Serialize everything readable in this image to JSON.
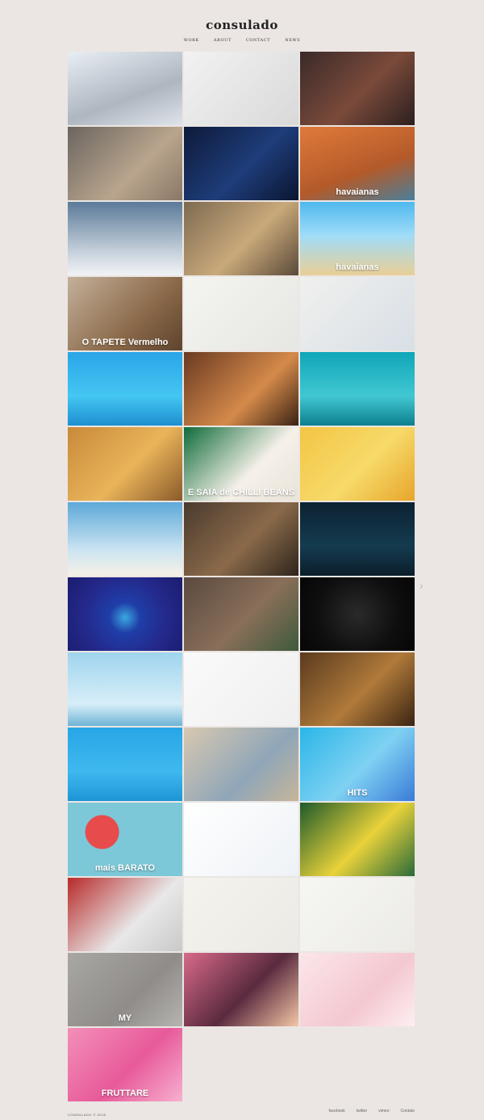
{
  "header": {
    "logo": "consulado",
    "nav": [
      {
        "key": "work",
        "label": "WORK"
      },
      {
        "key": "about",
        "label": "ABOUT"
      },
      {
        "key": "contact",
        "label": "CONTACT"
      },
      {
        "key": "news",
        "label": "NEWS"
      }
    ]
  },
  "tiles": [
    {
      "name": "car-wireframe",
      "label": "",
      "bg": "linear-gradient(160deg,#e9eef4,#aeb6c0 60%,#dfe4ea)"
    },
    {
      "name": "melitta-woman",
      "label": "",
      "bg": "linear-gradient(135deg,#f2f2f2,#d9d9d9)"
    },
    {
      "name": "animated-girl",
      "label": "",
      "bg": "linear-gradient(135deg,#3b2a2a,#7a4a3a 55%,#2b1f1f)"
    },
    {
      "name": "old-men-table",
      "label": "",
      "bg": "linear-gradient(135deg,#6b6560,#b9a58d 60%,#8a7766)"
    },
    {
      "name": "penguin",
      "label": "",
      "bg": "linear-gradient(135deg,#0e1a3a,#1e3d7a 55%,#0b1530)"
    },
    {
      "name": "havaianas-sandals",
      "label": "havaianas",
      "bg": "linear-gradient(160deg,#e07a3a,#b35a2a 60%,#4a7f9a)"
    },
    {
      "name": "skydivers",
      "label": "",
      "bg": "linear-gradient(180deg,#5b7a99,#c9d3dd 70%,#f1f3f5)"
    },
    {
      "name": "confetti-kiss",
      "label": "",
      "bg": "linear-gradient(135deg,#7d6a52,#c9a97a 55%,#5a4a3a)"
    },
    {
      "name": "havaianas-beach",
      "label": "havaianas",
      "bg": "linear-gradient(180deg,#4fb8ee,#9fdcf9 45%,#e9cf96)"
    },
    {
      "name": "tapete-vermelho",
      "label": "O TAPETE Vermelho",
      "bg": "linear-gradient(135deg,#c3b09a,#8b6a4a 60%,#5e432d)"
    },
    {
      "name": "sketch-drawing",
      "label": "",
      "bg": "linear-gradient(135deg,#f4f4f1,#e6e6e2)"
    },
    {
      "name": "tablet-city",
      "label": "",
      "bg": "linear-gradient(135deg,#f0f0ee,#d8dfe6)"
    },
    {
      "name": "cereal-box",
      "label": "",
      "bg": "linear-gradient(180deg,#2aa5e8,#44c6f2 60%,#1e8fd0)"
    },
    {
      "name": "robots",
      "label": "",
      "bg": "linear-gradient(135deg,#6a3a22,#d48a4a 60%,#3a2214)"
    },
    {
      "name": "underwater-kids",
      "label": "",
      "bg": "linear-gradient(180deg,#10a6b8,#41c7d2 60%,#0d7f8e)"
    },
    {
      "name": "cartoon-safe",
      "label": "",
      "bg": "linear-gradient(135deg,#c98a3a,#e9b45a 55%,#8a5a2a)"
    },
    {
      "name": "chilli-beans",
      "label": "E SAIA de CHILLI BEANS",
      "bg": "linear-gradient(135deg,#0f6b3a,#f5f0e8 60%,#e9e4da)"
    },
    {
      "name": "flying-hero",
      "label": "",
      "bg": "linear-gradient(135deg,#f3c544,#f7da6a 55%,#e6a52a)"
    },
    {
      "name": "cartoon-man-sky",
      "label": "",
      "bg": "linear-gradient(180deg,#5da8d8,#cbe4f2 65%,#f7f1e6)"
    },
    {
      "name": "action-scene",
      "label": "",
      "bg": "linear-gradient(135deg,#4a3a2e,#8a6a4a 55%,#2e241c)"
    },
    {
      "name": "night-desk",
      "label": "",
      "bg": "linear-gradient(180deg,#0b2232,#153b4f 60%,#0b1e2a)"
    },
    {
      "name": "globe",
      "label": "",
      "bg": "radial-gradient(circle at 50% 55%,#3aa7e0 0,#1f3ea8 22%,#24288a 60%,#1a1d6e 100%)"
    },
    {
      "name": "ruins-jungle",
      "label": "",
      "bg": "linear-gradient(135deg,#5a4a40,#8a6f5a 55%,#3e5a3a)"
    },
    {
      "name": "dark-burst",
      "label": "",
      "bg": "radial-gradient(circle at 50% 50%,#2a2a2a 0,#0e0e0e 60%,#060606 100%)"
    },
    {
      "name": "airplane",
      "label": "",
      "bg": "linear-gradient(180deg,#9fd4ee,#d7eef8 70%,#6fb5d6)"
    },
    {
      "name": "shoes-woman",
      "label": "",
      "bg": "linear-gradient(135deg,#fafafa,#efefef)"
    },
    {
      "name": "bmx-rider",
      "label": "",
      "bg": "linear-gradient(135deg,#5a3a1e,#b07a3a 55%,#3a2412)"
    },
    {
      "name": "floating-house",
      "label": "",
      "bg": "linear-gradient(180deg,#27a6e6,#3fb8ef 60%,#1d95d6)"
    },
    {
      "name": "selfie-couple",
      "label": "",
      "bg": "linear-gradient(135deg,#d8c8b0,#8fa6b8 60%,#c7b59a)"
    },
    {
      "name": "tv-hits",
      "label": "HITS",
      "bg": "linear-gradient(135deg,#2ab6e8,#7fd1f2 55%,#3a7ad8)"
    },
    {
      "name": "extra-mais-barato",
      "label": "mais BARATO",
      "bg": "radial-gradient(circle at 30% 40%,#e84b4b 0,#e84b4b 18%,#7cc8d8 19%,#7cc8d8 100%)"
    },
    {
      "name": "click-hand",
      "label": "",
      "bg": "linear-gradient(135deg,#ffffff,#eef2f6)"
    },
    {
      "name": "surfing-girl",
      "label": "",
      "bg": "linear-gradient(135deg,#1e5a2a,#e9d23a 55%,#2a6a3a)"
    },
    {
      "name": "red-machine",
      "label": "",
      "bg": "linear-gradient(135deg,#b82a2a,#e8e8e8 60%,#c9c9c9)"
    },
    {
      "name": "sunglasses",
      "label": "",
      "bg": "linear-gradient(135deg,#f4f3ee,#ebeae4)"
    },
    {
      "name": "colorful-logo",
      "label": "",
      "bg": "linear-gradient(135deg,#f6f6f3,#ecebe6)"
    },
    {
      "name": "my-letters",
      "label": "MY",
      "bg": "linear-gradient(135deg,#a9a7a4,#8f8c89 60%,#b6b4b0)"
    },
    {
      "name": "dog-comic",
      "label": "",
      "bg": "linear-gradient(135deg,#d86a8a,#5a2a3e 55%,#f3c7a6)"
    },
    {
      "name": "strawberry-splash",
      "label": "",
      "bg": "linear-gradient(135deg,#fbe6ea,#f4c8d0 60%,#fdeff2)"
    },
    {
      "name": "fruttare",
      "label": "FRUTTARE",
      "bg": "linear-gradient(135deg,#f28fb8,#e85a9a 55%,#f7b0cf)"
    }
  ],
  "pager": {
    "next_icon": "chevron-right-icon"
  },
  "footer": {
    "copyright": "consulado © 2015",
    "links": [
      {
        "key": "facebook",
        "label": "facebook"
      },
      {
        "key": "twitter",
        "label": "twitter"
      },
      {
        "key": "vimeo",
        "label": "vimeo"
      },
      {
        "key": "contact",
        "label": "Contato"
      }
    ]
  }
}
